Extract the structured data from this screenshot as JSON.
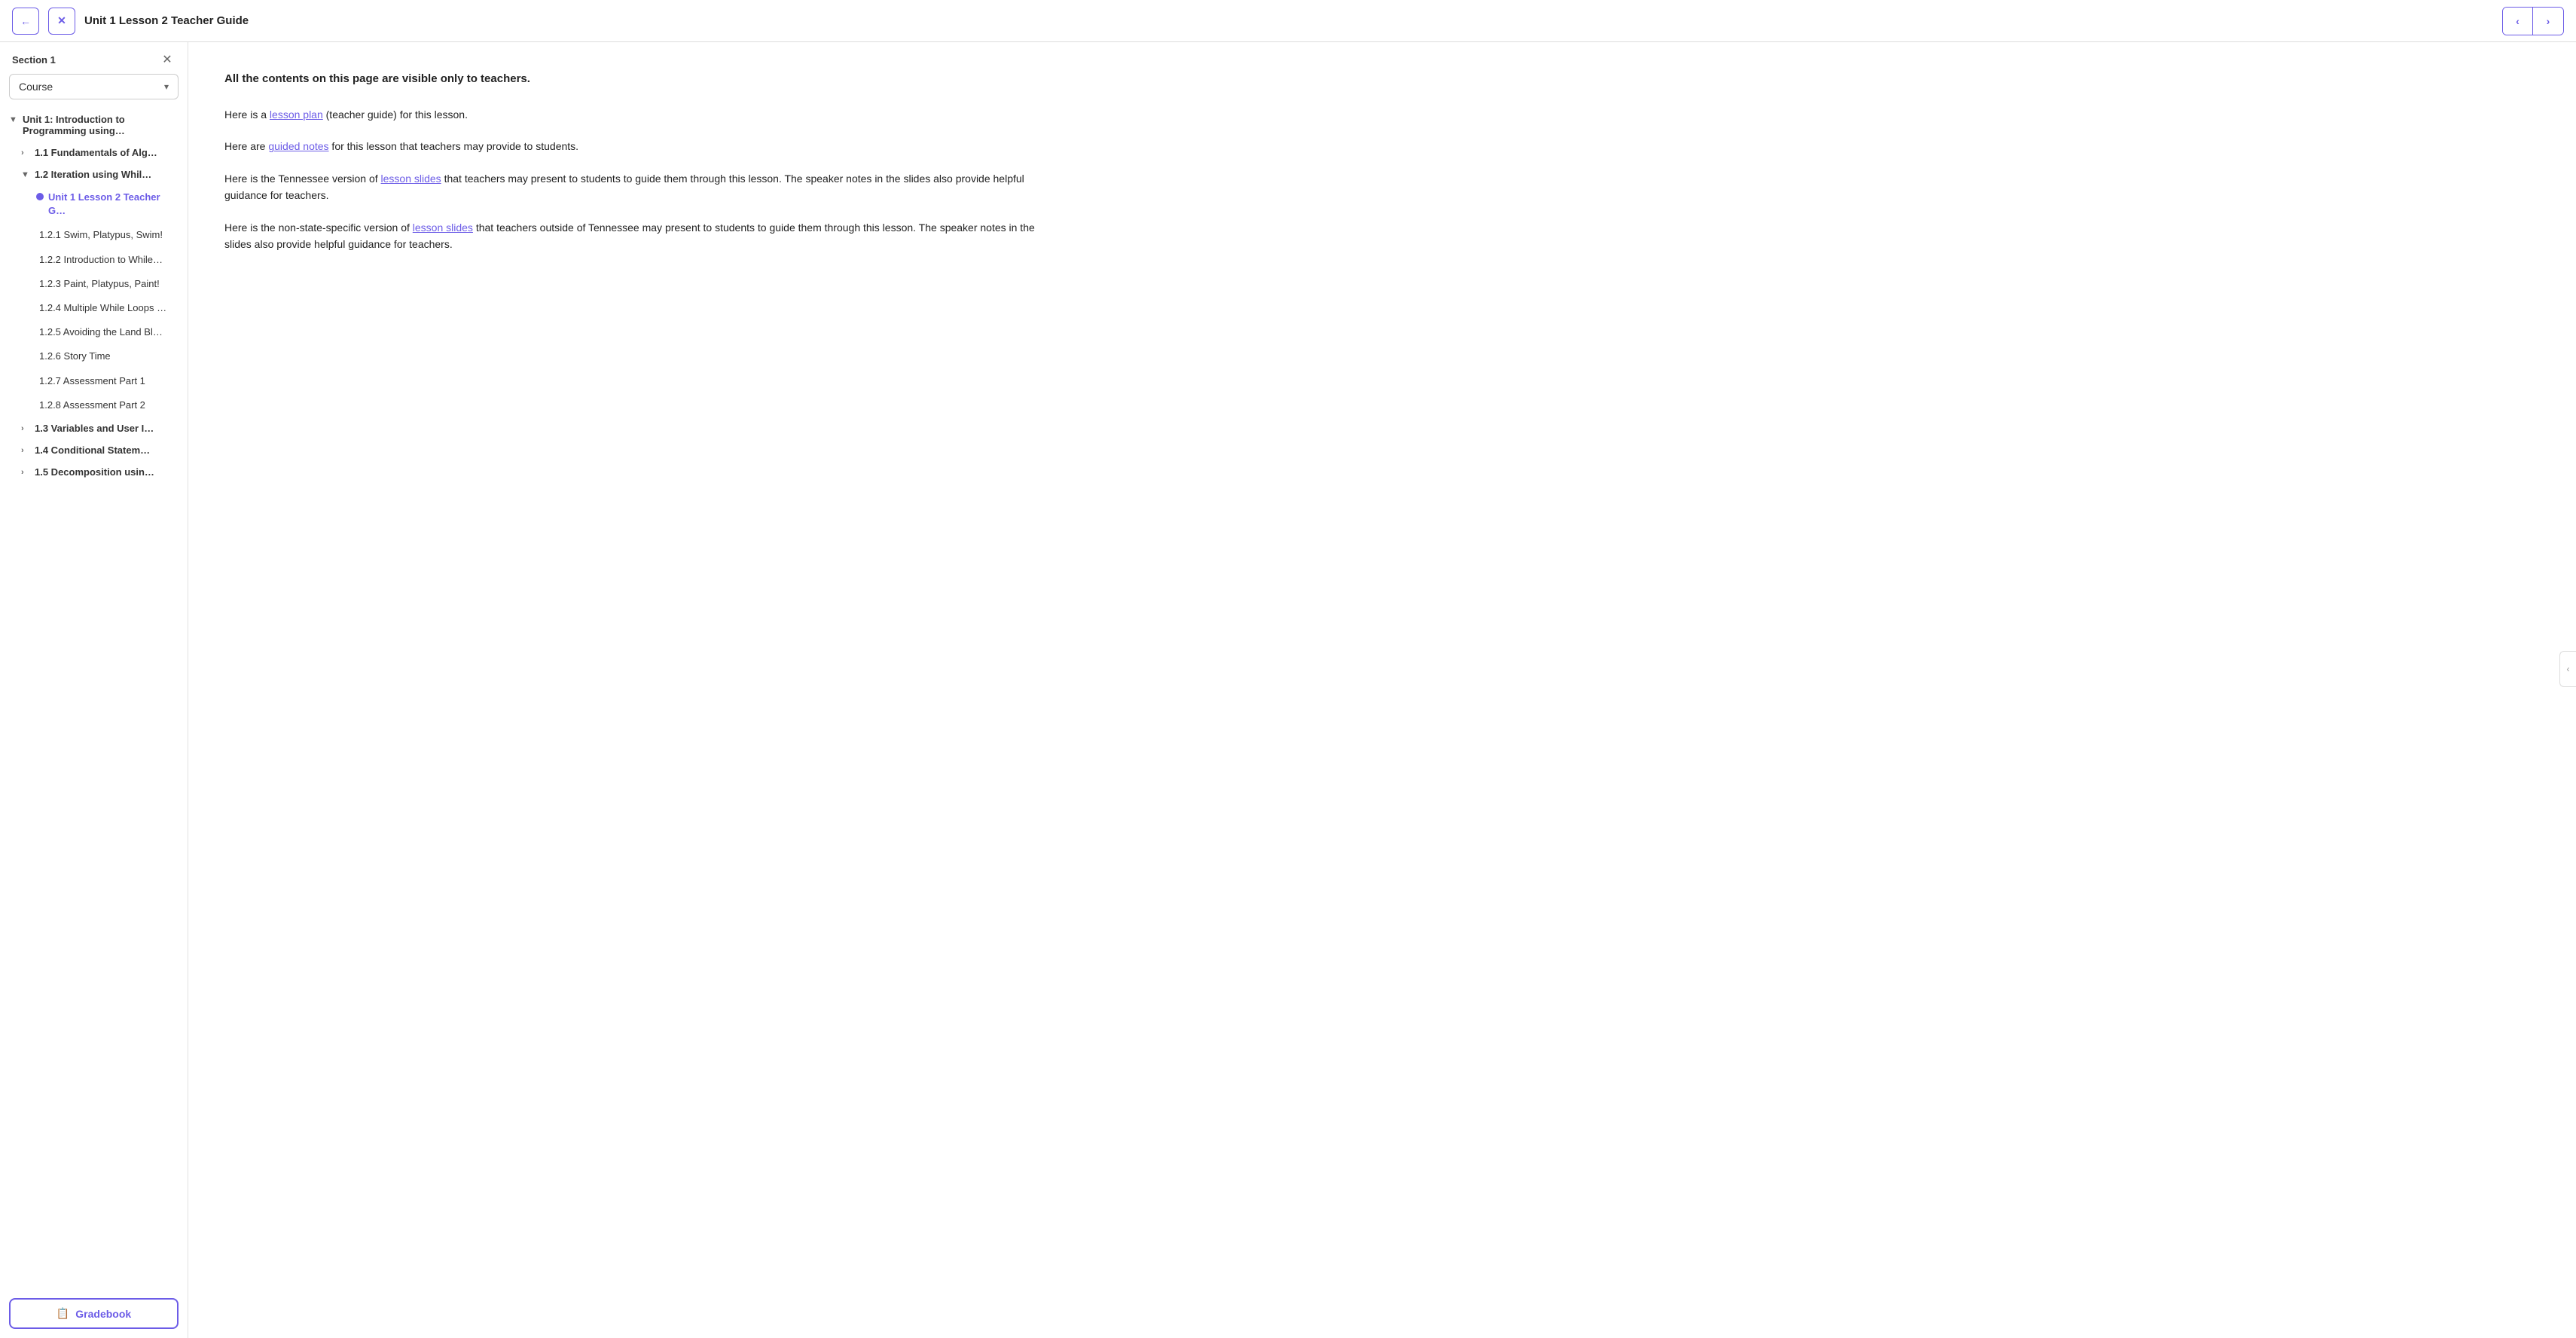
{
  "header": {
    "back_label": "←",
    "close_label": "✕",
    "title": "Unit 1 Lesson 2 Teacher Guide",
    "prev_label": "‹",
    "next_label": "›"
  },
  "sidebar": {
    "section_label": "Section 1",
    "close_label": "✕",
    "dropdown_label": "Course",
    "dropdown_arrow": "▾",
    "tree": {
      "unit1_label": "Unit 1: Introduction to Programming using…",
      "item_1_1": "1.1 Fundamentals of Alg…",
      "item_1_2": "1.2 Iteration using Whil…",
      "item_1_2_active": "Unit 1 Lesson 2 Teacher G…",
      "sub_items": [
        {
          "label": "1.2.1 Swim, Platypus, Swim!"
        },
        {
          "label": "1.2.2 Introduction to While…"
        },
        {
          "label": "1.2.3 Paint, Platypus, Paint!"
        },
        {
          "label": "1.2.4 Multiple While Loops …"
        },
        {
          "label": "1.2.5 Avoiding the Land Bl…"
        },
        {
          "label": "1.2.6 Story Time"
        },
        {
          "label": "1.2.7 Assessment Part 1"
        },
        {
          "label": "1.2.8 Assessment Part 2"
        }
      ],
      "item_1_3": "1.3 Variables and User I…",
      "item_1_4": "1.4 Conditional Statem…",
      "item_1_5": "1.5 Decomposition usin…"
    },
    "gradebook_icon": "☰",
    "gradebook_label": "Gradebook"
  },
  "content": {
    "notice": "All the contents on this page are visible only to teachers.",
    "para1_prefix": "Here is a ",
    "para1_link": "lesson plan",
    "para1_suffix": " (teacher guide) for this lesson.",
    "para2_prefix": "Here are ",
    "para2_link": "guided notes",
    "para2_suffix": " for this lesson that teachers may provide to students.",
    "para3_prefix": "Here is the Tennessee version of ",
    "para3_link": "lesson slides",
    "para3_suffix": " that teachers may present to students to guide them through this lesson. The speaker notes in the slides also provide helpful guidance for teachers.",
    "para4_prefix": "Here is the non-state-specific version of ",
    "para4_link": "lesson slides",
    "para4_suffix": " that teachers outside of Tennessee may present to students to guide them through this lesson. The speaker notes in the slides also provide helpful guidance for teachers."
  },
  "right_collapse": "‹"
}
